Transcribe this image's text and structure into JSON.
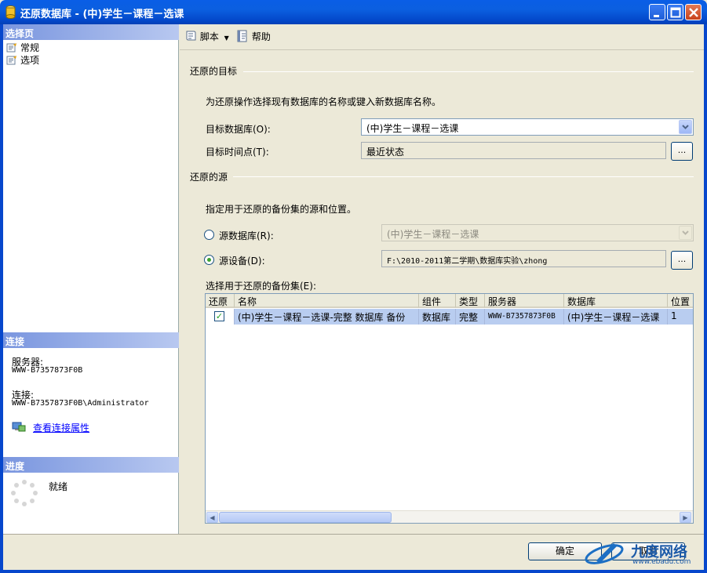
{
  "window": {
    "title": "还原数据库 - (中)学生－课程－选课"
  },
  "left": {
    "select_page_header": "选择页",
    "nav_items": [
      {
        "label": "常规"
      },
      {
        "label": "选项"
      }
    ],
    "connection_header": "连接",
    "server_label": "服务器:",
    "server_value": "WWW-B7357873F0B",
    "connection_label": "连接:",
    "connection_value": "WWW-B7357873F0B\\Administrator",
    "view_connection_properties": "查看连接属性",
    "progress_header": "进度",
    "progress_status": "就绪"
  },
  "toolbar": {
    "script_label": "脚本",
    "help_label": "帮助"
  },
  "destination": {
    "group_title": "还原的目标",
    "description": "为还原操作选择现有数据库的名称或键入新数据库名称。",
    "to_database_label": "目标数据库(O):",
    "to_database_value": "(中)学生－课程－选课",
    "point_in_time_label": "目标时间点(T):",
    "point_in_time_value": "最近状态",
    "browse_label": "..."
  },
  "source": {
    "group_title": "还原的源",
    "description": "指定用于还原的备份集的源和位置。",
    "from_database_label": "源数据库(R):",
    "from_database_value": "(中)学生－课程－选课",
    "from_device_label": "源设备(D):",
    "from_device_value": "F:\\2010-2011第二学期\\数据库实验\\zhong",
    "browse_label": "..."
  },
  "backup_sets": {
    "label": "选择用于还原的备份集(E):",
    "columns": [
      "还原",
      "名称",
      "组件",
      "类型",
      "服务器",
      "数据库",
      "位置"
    ],
    "rows": [
      {
        "restore": "✓",
        "name": "(中)学生－课程－选课-完整 数据库 备份",
        "component": "数据库",
        "type": "完整",
        "server": "WWW-B7357873F0B",
        "database": "(中)学生－课程－选课",
        "position": "1"
      }
    ]
  },
  "footer": {
    "ok_label": "确定",
    "cancel_label": "取消"
  },
  "watermark": {
    "text": "九度网络",
    "url_text": "www.ebadu.com"
  },
  "colors": {
    "title_bar": "#0b5fe0",
    "section_header": "#7a96df",
    "selected_row": "#b9cdf0"
  }
}
